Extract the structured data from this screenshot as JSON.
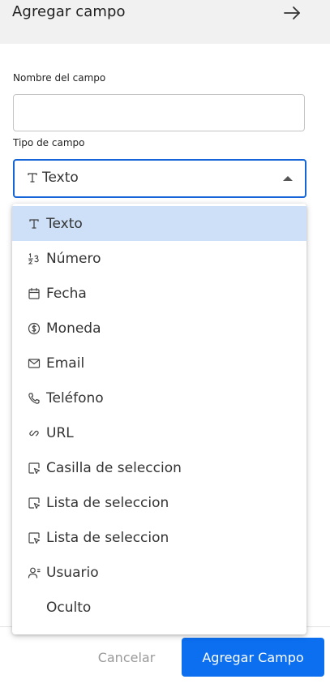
{
  "header": {
    "title": "Agregar campo",
    "back_icon": "arrow-right-icon"
  },
  "form": {
    "name_label": "Nombre del campo",
    "name_value": "",
    "type_label": "Tipo de campo",
    "type_selected": "Texto",
    "type_selected_icon": "text-type-icon"
  },
  "menu": {
    "items": [
      {
        "label": "Texto",
        "icon": "text-type-icon",
        "selected": true
      },
      {
        "label": "Número",
        "icon": "number-icon",
        "selected": false
      },
      {
        "label": "Fecha",
        "icon": "calendar-icon",
        "selected": false
      },
      {
        "label": "Moneda",
        "icon": "dollar-icon",
        "selected": false
      },
      {
        "label": "Email",
        "icon": "mail-icon",
        "selected": false
      },
      {
        "label": "Teléfono",
        "icon": "phone-icon",
        "selected": false
      },
      {
        "label": "URL",
        "icon": "link-icon",
        "selected": false
      },
      {
        "label": "Casilla de seleccion",
        "icon": "select-cursor-icon",
        "selected": false
      },
      {
        "label": "Lista de seleccion",
        "icon": "select-cursor-icon",
        "selected": false
      },
      {
        "label": "Lista de seleccion",
        "icon": "select-cursor-icon",
        "selected": false
      },
      {
        "label": "Usuario",
        "icon": "user-icon",
        "selected": false
      },
      {
        "label": "Oculto",
        "icon": "",
        "selected": false
      }
    ]
  },
  "footer": {
    "cancel_label": "Cancelar",
    "submit_label": "Agregar Campo"
  },
  "colors": {
    "accent": "#0b6ff0",
    "select_border": "#1565d8",
    "selected_item_bg": "#cde0f7",
    "header_bg": "#f1f1f1"
  }
}
